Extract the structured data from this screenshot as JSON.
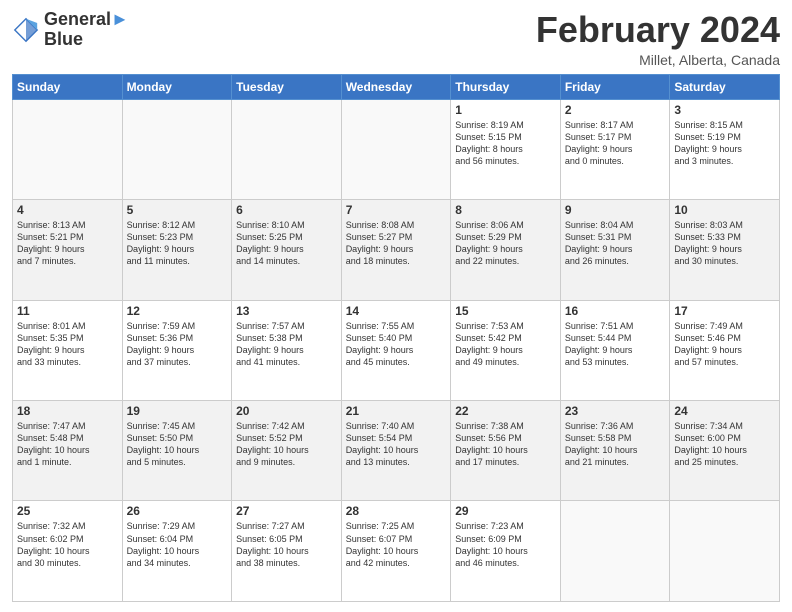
{
  "logo": {
    "line1": "General",
    "line2": "Blue"
  },
  "header": {
    "month": "February 2024",
    "location": "Millet, Alberta, Canada"
  },
  "weekdays": [
    "Sunday",
    "Monday",
    "Tuesday",
    "Wednesday",
    "Thursday",
    "Friday",
    "Saturday"
  ],
  "weeks": [
    [
      {
        "day": "",
        "info": ""
      },
      {
        "day": "",
        "info": ""
      },
      {
        "day": "",
        "info": ""
      },
      {
        "day": "",
        "info": ""
      },
      {
        "day": "1",
        "info": "Sunrise: 8:19 AM\nSunset: 5:15 PM\nDaylight: 8 hours\nand 56 minutes."
      },
      {
        "day": "2",
        "info": "Sunrise: 8:17 AM\nSunset: 5:17 PM\nDaylight: 9 hours\nand 0 minutes."
      },
      {
        "day": "3",
        "info": "Sunrise: 8:15 AM\nSunset: 5:19 PM\nDaylight: 9 hours\nand 3 minutes."
      }
    ],
    [
      {
        "day": "4",
        "info": "Sunrise: 8:13 AM\nSunset: 5:21 PM\nDaylight: 9 hours\nand 7 minutes."
      },
      {
        "day": "5",
        "info": "Sunrise: 8:12 AM\nSunset: 5:23 PM\nDaylight: 9 hours\nand 11 minutes."
      },
      {
        "day": "6",
        "info": "Sunrise: 8:10 AM\nSunset: 5:25 PM\nDaylight: 9 hours\nand 14 minutes."
      },
      {
        "day": "7",
        "info": "Sunrise: 8:08 AM\nSunset: 5:27 PM\nDaylight: 9 hours\nand 18 minutes."
      },
      {
        "day": "8",
        "info": "Sunrise: 8:06 AM\nSunset: 5:29 PM\nDaylight: 9 hours\nand 22 minutes."
      },
      {
        "day": "9",
        "info": "Sunrise: 8:04 AM\nSunset: 5:31 PM\nDaylight: 9 hours\nand 26 minutes."
      },
      {
        "day": "10",
        "info": "Sunrise: 8:03 AM\nSunset: 5:33 PM\nDaylight: 9 hours\nand 30 minutes."
      }
    ],
    [
      {
        "day": "11",
        "info": "Sunrise: 8:01 AM\nSunset: 5:35 PM\nDaylight: 9 hours\nand 33 minutes."
      },
      {
        "day": "12",
        "info": "Sunrise: 7:59 AM\nSunset: 5:36 PM\nDaylight: 9 hours\nand 37 minutes."
      },
      {
        "day": "13",
        "info": "Sunrise: 7:57 AM\nSunset: 5:38 PM\nDaylight: 9 hours\nand 41 minutes."
      },
      {
        "day": "14",
        "info": "Sunrise: 7:55 AM\nSunset: 5:40 PM\nDaylight: 9 hours\nand 45 minutes."
      },
      {
        "day": "15",
        "info": "Sunrise: 7:53 AM\nSunset: 5:42 PM\nDaylight: 9 hours\nand 49 minutes."
      },
      {
        "day": "16",
        "info": "Sunrise: 7:51 AM\nSunset: 5:44 PM\nDaylight: 9 hours\nand 53 minutes."
      },
      {
        "day": "17",
        "info": "Sunrise: 7:49 AM\nSunset: 5:46 PM\nDaylight: 9 hours\nand 57 minutes."
      }
    ],
    [
      {
        "day": "18",
        "info": "Sunrise: 7:47 AM\nSunset: 5:48 PM\nDaylight: 10 hours\nand 1 minute."
      },
      {
        "day": "19",
        "info": "Sunrise: 7:45 AM\nSunset: 5:50 PM\nDaylight: 10 hours\nand 5 minutes."
      },
      {
        "day": "20",
        "info": "Sunrise: 7:42 AM\nSunset: 5:52 PM\nDaylight: 10 hours\nand 9 minutes."
      },
      {
        "day": "21",
        "info": "Sunrise: 7:40 AM\nSunset: 5:54 PM\nDaylight: 10 hours\nand 13 minutes."
      },
      {
        "day": "22",
        "info": "Sunrise: 7:38 AM\nSunset: 5:56 PM\nDaylight: 10 hours\nand 17 minutes."
      },
      {
        "day": "23",
        "info": "Sunrise: 7:36 AM\nSunset: 5:58 PM\nDaylight: 10 hours\nand 21 minutes."
      },
      {
        "day": "24",
        "info": "Sunrise: 7:34 AM\nSunset: 6:00 PM\nDaylight: 10 hours\nand 25 minutes."
      }
    ],
    [
      {
        "day": "25",
        "info": "Sunrise: 7:32 AM\nSunset: 6:02 PM\nDaylight: 10 hours\nand 30 minutes."
      },
      {
        "day": "26",
        "info": "Sunrise: 7:29 AM\nSunset: 6:04 PM\nDaylight: 10 hours\nand 34 minutes."
      },
      {
        "day": "27",
        "info": "Sunrise: 7:27 AM\nSunset: 6:05 PM\nDaylight: 10 hours\nand 38 minutes."
      },
      {
        "day": "28",
        "info": "Sunrise: 7:25 AM\nSunset: 6:07 PM\nDaylight: 10 hours\nand 42 minutes."
      },
      {
        "day": "29",
        "info": "Sunrise: 7:23 AM\nSunset: 6:09 PM\nDaylight: 10 hours\nand 46 minutes."
      },
      {
        "day": "",
        "info": ""
      },
      {
        "day": "",
        "info": ""
      }
    ]
  ]
}
